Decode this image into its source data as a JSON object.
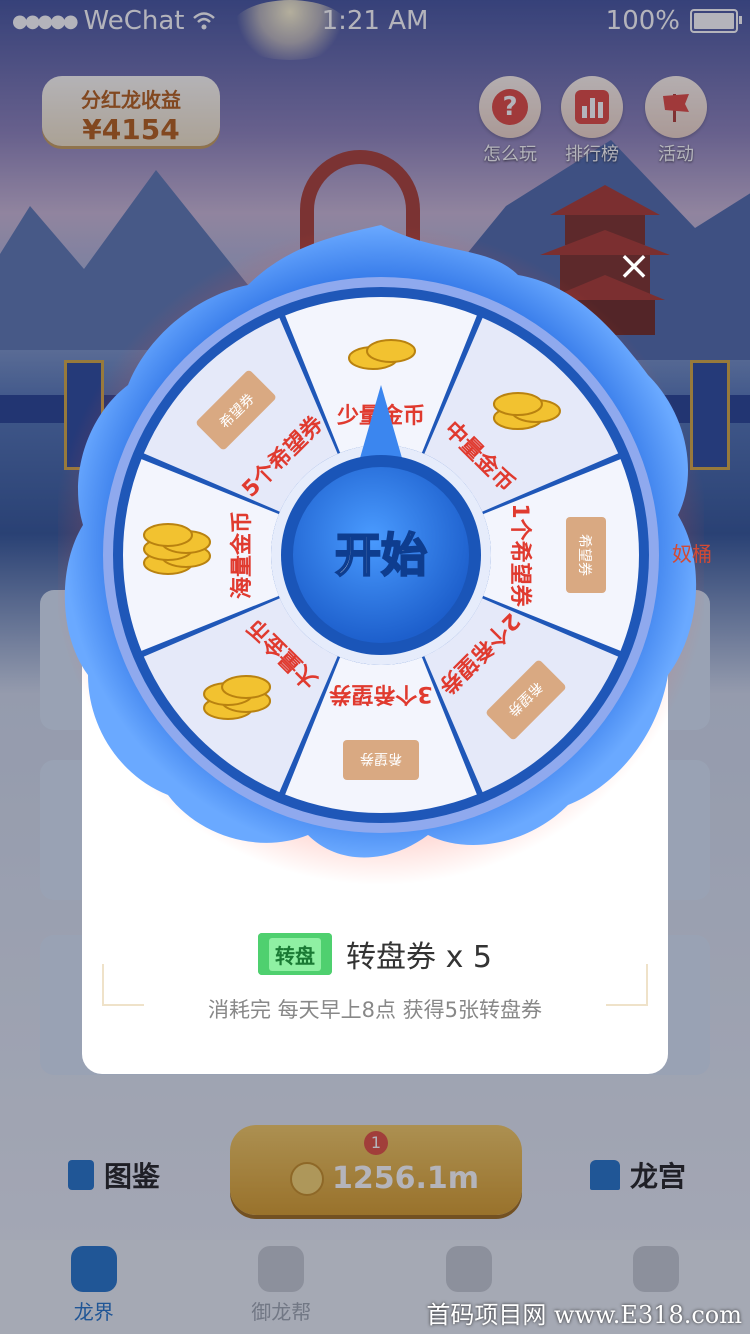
{
  "status_bar": {
    "carrier": "WeChat",
    "time": "1:21 AM",
    "battery": "100%"
  },
  "earnings": {
    "label": "分红龙收益",
    "value": "¥4154"
  },
  "top_buttons": [
    {
      "label": "怎么玩",
      "icon": "question-icon"
    },
    {
      "label": "排行榜",
      "icon": "ranking-icon"
    },
    {
      "label": "活动",
      "icon": "flag-icon"
    }
  ],
  "wheel": {
    "start_label": "开始",
    "segments": [
      "少量金币",
      "中量金币",
      "1个希望券",
      "2个希望券",
      "3个希望券",
      "大量金币",
      "海量金币",
      "5个希望券"
    ],
    "ticket_tag": "希望券",
    "ticket_counts": [
      "1个",
      "2个",
      "3个",
      "5个"
    ]
  },
  "right_edge_text": "奴桶",
  "modal": {
    "ticket_badge": "转盘",
    "ticket_text": "转盘券 x 5",
    "hint": "消耗完 每天早上8点 获得5张转盘券",
    "close_label": "×"
  },
  "game_bar": {
    "left": "图鉴",
    "right": "龙宫",
    "coin_badge": "1",
    "coin_value": "1256.1m"
  },
  "tabs": [
    {
      "label": "龙界",
      "active": true
    },
    {
      "label": "御龙帮",
      "active": false
    },
    {
      "label": "",
      "active": false
    },
    {
      "label": "",
      "active": false
    }
  ],
  "watermark": "首码项目网  www.E318.com",
  "colors": {
    "accent": "#1c6fc7",
    "wheel_blue": "#2f74e6",
    "segment_text": "#e03a2f",
    "coin": "#f2c230"
  }
}
